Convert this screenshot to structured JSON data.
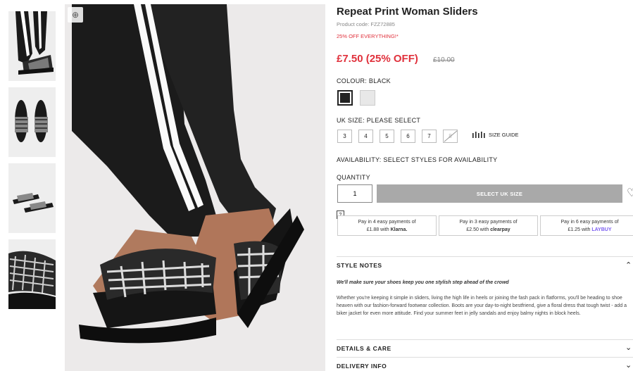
{
  "gallery": {
    "thumbnails": [
      "Thumbnail 1",
      "Thumbnail 2",
      "Thumbnail 3",
      "Thumbnail 4"
    ],
    "zoom_icon": "magnifier-plus-icon"
  },
  "product": {
    "title": "Repeat Print Woman Sliders",
    "product_code": "Product code: FZZ72885",
    "promo": "25% OFF EVERYTHING!*",
    "price": "£7.50 (25% OFF)",
    "old_price": "£10.00",
    "colour_label": "COLOUR:",
    "colour_value": "BLACK",
    "size_label": "UK SIZE:",
    "size_value": "PLEASE SELECT",
    "sizes": [
      "3",
      "4",
      "5",
      "6",
      "7",
      "8"
    ],
    "size_guide": "SIZE GUIDE",
    "availability_label": "AVAILABILITY:",
    "availability_value": "SELECT STYLES FOR AVAILABILITY",
    "quantity_label": "QUANTITY",
    "quantity_value": "1",
    "add_button": "SELECT UK SIZE",
    "help": "?"
  },
  "payments": [
    {
      "line1": "Pay in 4 easy payments of",
      "amount": "£1.88 with",
      "brand": "Klarna."
    },
    {
      "line1": "Pay in 3 easy payments of",
      "amount": "£2.50 with",
      "brand": "clearpay"
    },
    {
      "line1": "Pay in 6 easy payments of",
      "amount": "£1.25 with",
      "brand": "LAYBUY"
    }
  ],
  "accordion": {
    "style_notes": "STYLE NOTES",
    "tagline": "We'll make sure your shoes keep you one stylish step ahead of the crowd",
    "description": "Whether you're keeping it simple in sliders, living the high life in heels or joining the fash pack in flatforms, you'll be heading to shoe heaven with our fashion-forward footwear collection. Boots are your day-to-night bestfriend, give a floral dress that tough twist - add a biker jacket for even more attitude. Find your summer feet in jelly sandals and enjoy balmy nights in block heels.",
    "details": "DETAILS & CARE",
    "delivery": "DELIVERY INFO"
  },
  "colors": {
    "accent_red": "#e0313c",
    "button_grey": "#a9a9a9"
  }
}
